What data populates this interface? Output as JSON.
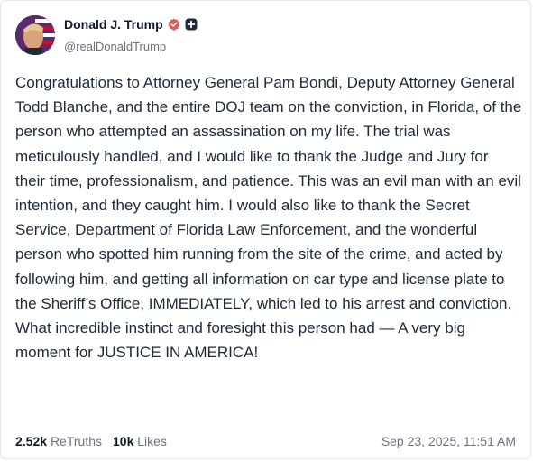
{
  "author": {
    "name": "Donald J. Trump",
    "handle": "@realDonaldTrump"
  },
  "post": {
    "text": "Congratulations to Attorney General Pam Bondi, Deputy Attorney General Todd Blanche, and the entire DOJ team on the conviction, in Florida, of the person who attempted an assassination on my life. The trial was meticulously handled, and I would like to thank the Judge and Jury for their time, professionalism, and patience. This was an evil man with an evil intention, and they caught him. I would also like to thank the Secret Service, Department of Florida Law Enforcement, and the wonderful person who spotted him running from the site of the crime, and acted by following him, and getting all information on car type and license plate to the Sheriff’s Office, IMMEDIATELY, which led to his arrest and conviction. What incredible instinct and foresight this person had — A very big moment for JUSTICE IN AMERICA!"
  },
  "stats": {
    "retruths_count": "2.52k",
    "retruths_label": "ReTruths",
    "likes_count": "10k",
    "likes_label": "Likes"
  },
  "timestamp": "Sep 23, 2025, 11:51 AM",
  "colors": {
    "verified_badge": "#e15a5a",
    "muted_text": "#6b7280",
    "body_text": "#1f2937"
  },
  "icons": {
    "verified": "verified-badge-icon",
    "plus": "plus-badge-icon"
  }
}
